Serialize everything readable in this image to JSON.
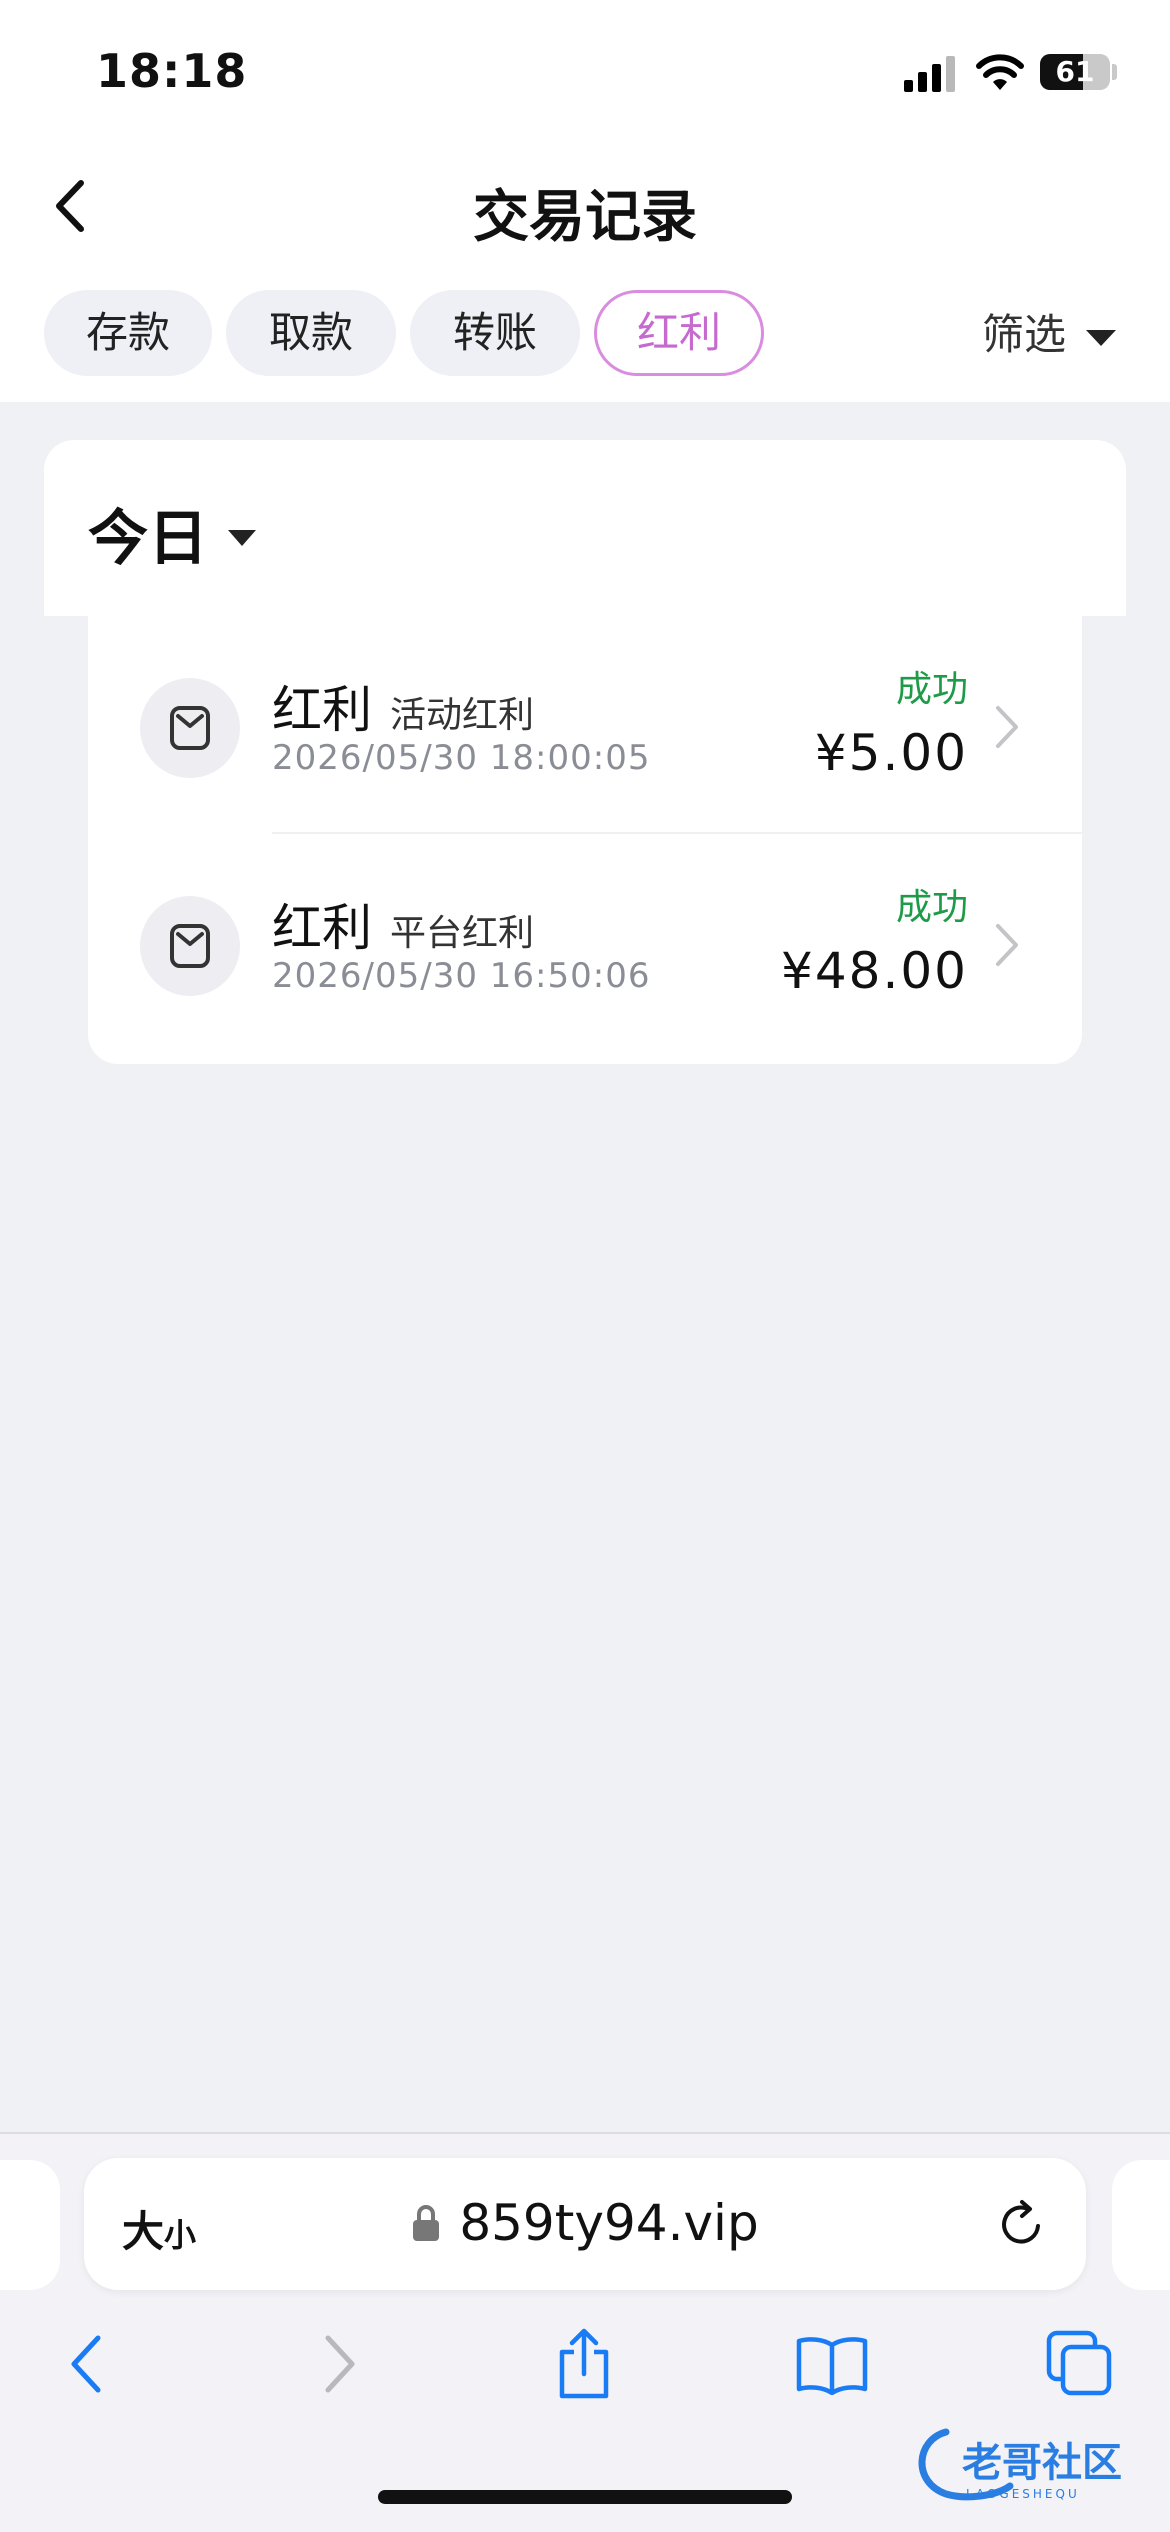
{
  "status_bar": {
    "time": "18:18",
    "battery": "61",
    "battery_level": 0.61
  },
  "nav": {
    "title": "交易记录"
  },
  "tabs": [
    {
      "label": "存款",
      "active": false
    },
    {
      "label": "取款",
      "active": false
    },
    {
      "label": "转账",
      "active": false
    },
    {
      "label": "红利",
      "active": true
    }
  ],
  "filter": {
    "label": "筛选"
  },
  "date_group": {
    "label": "今日"
  },
  "records": [
    {
      "type": "红利",
      "subtype": "活动红利",
      "time": "2026/05/30 18:00:05",
      "status": "成功",
      "amount": "¥5.00"
    },
    {
      "type": "红利",
      "subtype": "平台红利",
      "time": "2026/05/30 16:50:06",
      "status": "成功",
      "amount": "¥48.00"
    }
  ],
  "browser": {
    "text_size": "大",
    "text_size_small": "小",
    "url": "859ty94.vip"
  },
  "watermark": {
    "text": "老哥社区",
    "subtext": "LAOGESHEQU"
  },
  "colors": {
    "accent": "#c66ad0",
    "success": "#1e9b48",
    "ios_blue": "#1a7cf5"
  }
}
